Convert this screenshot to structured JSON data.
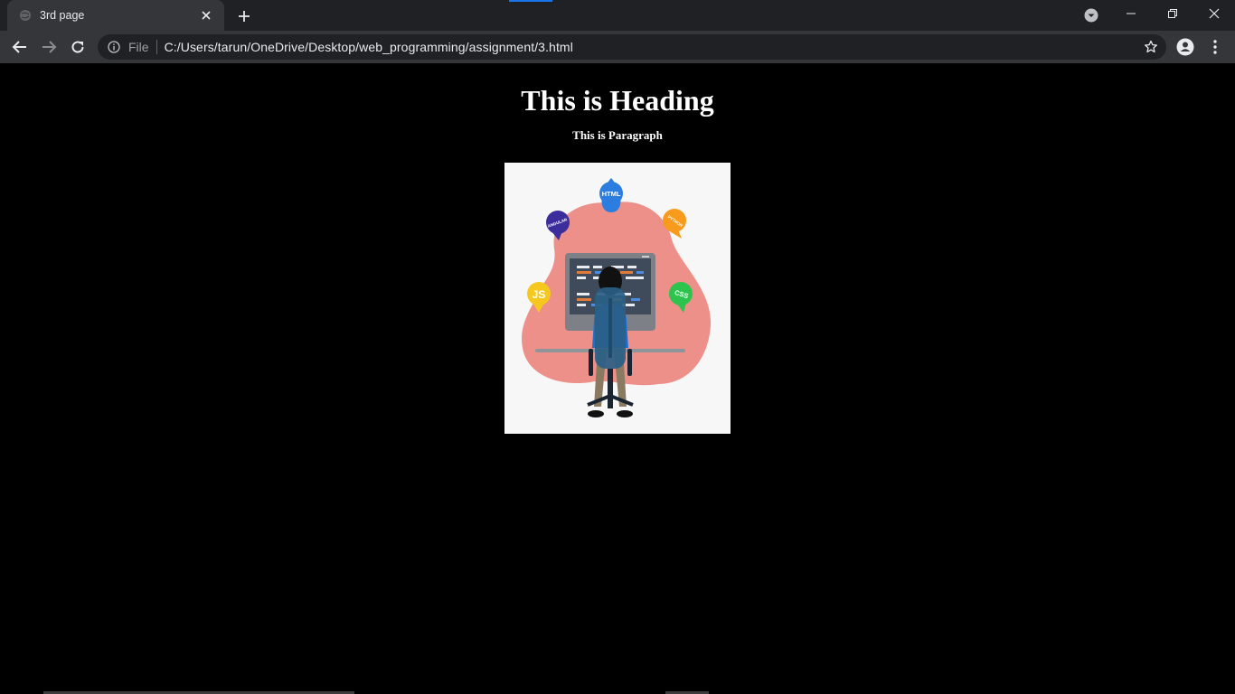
{
  "browser": {
    "tab": {
      "title": "3rd page",
      "favicon": "globe-icon"
    },
    "new_tab_icon": "plus-icon",
    "window_controls": [
      "minimize-icon",
      "restore-icon",
      "close-icon"
    ],
    "omnibox": {
      "scheme_label": "File",
      "url": "C:/Users/tarun/OneDrive/Desktop/web_programming/assignment/3.html"
    },
    "accent_color": "#1a73e8"
  },
  "page": {
    "heading": "This is Heading",
    "paragraph": "This is Paragraph",
    "image": {
      "bubbles": {
        "html": "HTML",
        "angular": "ANGULAR",
        "python": "PYTHON",
        "js": "JS",
        "css": "CSS"
      },
      "colors": {
        "background": "#f7f7f7",
        "blob": "#ed908a",
        "html": "#2b7de0",
        "angular": "#3b2d9c",
        "python": "#f89a1c",
        "js": "#f6c81d",
        "css": "#2dc44e"
      }
    }
  }
}
